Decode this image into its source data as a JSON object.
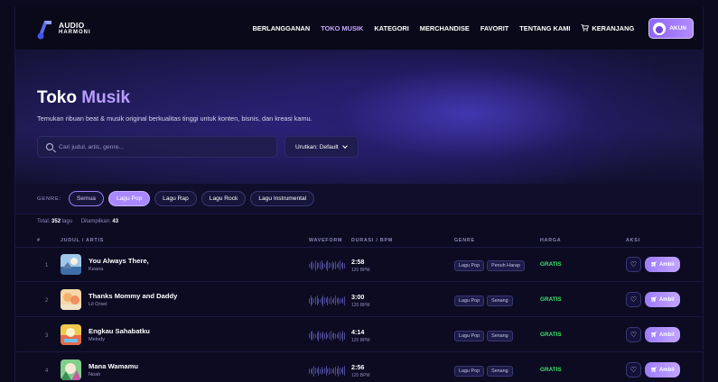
{
  "brand": {
    "line1": "AUDIO",
    "line2": "HARMONI"
  },
  "nav": {
    "links": [
      "BERLANGGANAN",
      "TOKO MUSIK",
      "KATEGORI",
      "MERCHANDISE",
      "FAVORIT",
      "TENTANG KAMI"
    ],
    "active_index": 1,
    "cart_label": "KERANJANG",
    "account_label": "AKUN"
  },
  "hero": {
    "title_plain": "Toko",
    "title_accent": "Musik",
    "subtitle": "Temukan ribuan beat & musik original berkualitas tinggi untuk konten, bisnis, dan kreasi kamu.",
    "search_placeholder": "Cari judul, artis, genre...",
    "sort_label": "Urutkan: Default"
  },
  "filters": {
    "caption": "GENRE:",
    "chips": [
      "Semua",
      "Lagu Pop",
      "Lagu Rap",
      "Lagu Rock",
      "Lagu Instrumental"
    ],
    "outlined_index": 0,
    "selected_index": 1
  },
  "summary": {
    "total_label": "Total:",
    "total_value": "352",
    "total_unit": "lagu",
    "shown_label": "Ditampilkan:",
    "shown_value": "43"
  },
  "table": {
    "headers": {
      "num": "#",
      "title": "JUDUL / ARTIS",
      "waveform": "WAVEFORM",
      "duration": "DURASI / BPM",
      "genre": "GENRE",
      "price": "HARGA",
      "action": "AKSI"
    },
    "rows": [
      {
        "num": "1",
        "title": "You Always There,",
        "artist": "Keana",
        "duration": "2:58",
        "bpm": "120 BPM",
        "tags": [
          "Lagu Pop",
          "Penuh Harap"
        ],
        "price": "GRATIS",
        "buy": "Ambil"
      },
      {
        "num": "2",
        "title": "Thanks Mommy and Daddy",
        "artist": "Lil Orsel",
        "duration": "3:00",
        "bpm": "120 BPM",
        "tags": [
          "Lagu Pop",
          "Senang"
        ],
        "price": "GRATIS",
        "buy": "Ambil"
      },
      {
        "num": "3",
        "title": "Engkau Sahabatku",
        "artist": "Melody",
        "duration": "4:14",
        "bpm": "120 BPM",
        "tags": [
          "Lagu Pop",
          "Senang"
        ],
        "price": "GRATIS",
        "buy": "Ambil"
      },
      {
        "num": "4",
        "title": "Mana Wamamu",
        "artist": "Noah",
        "duration": "2:56",
        "bpm": "120 BPM",
        "tags": [
          "Lagu Pop",
          "Senang"
        ],
        "price": "GRATIS",
        "buy": "Ambil"
      }
    ]
  },
  "icons": {
    "search": "search-icon",
    "sort": "chevron-down-icon",
    "cart": "cart-icon",
    "heart": "heart-icon"
  },
  "colors": {
    "accent": "#a988ff",
    "price": "#3ee36b",
    "background": "#0c0b22"
  }
}
